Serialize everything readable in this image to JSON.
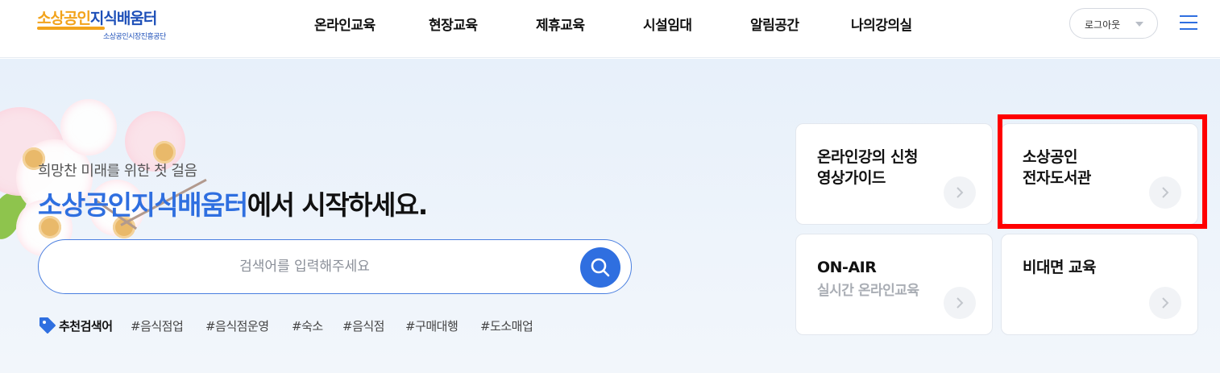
{
  "brand": {
    "logo_part1": "소상공인",
    "logo_part2": "지식배움터",
    "logo_sub": "소상공인시장진흥공단"
  },
  "nav": {
    "items": [
      "온라인교육",
      "현장교육",
      "제휴교육",
      "시설임대",
      "알림공간",
      "나의강의실"
    ]
  },
  "header": {
    "logout_label": "로그아웃",
    "menu_icon": "hamburger-menu-icon"
  },
  "hero": {
    "subtitle": "희망찬 미래를 위한 첫 걸음",
    "title_accent": "소상공인지식배움터",
    "title_rest": "에서 시작하세요."
  },
  "search": {
    "placeholder": "검색어를 입력해주세요",
    "value": ""
  },
  "recommended": {
    "label": "추천검색어",
    "tags": [
      "#음식점업",
      "#음식점운영",
      "#숙소",
      "#음식점",
      "#구매대행",
      "#도소매업"
    ]
  },
  "cards": [
    {
      "line1": "온라인강의 신청",
      "line2": "영상가이드",
      "subtitle": ""
    },
    {
      "line1": "소상공인",
      "line2": "전자도서관",
      "subtitle": ""
    },
    {
      "line1": "ON-AIR",
      "line2": "",
      "subtitle": "실시간 온라인교육"
    },
    {
      "line1": "비대면 교육",
      "line2": "",
      "subtitle": ""
    }
  ],
  "colors": {
    "accent": "#2f6fe0",
    "logo_orange": "#f2a31b",
    "logo_blue": "#1d4fb8",
    "highlight": "#ff0000"
  }
}
